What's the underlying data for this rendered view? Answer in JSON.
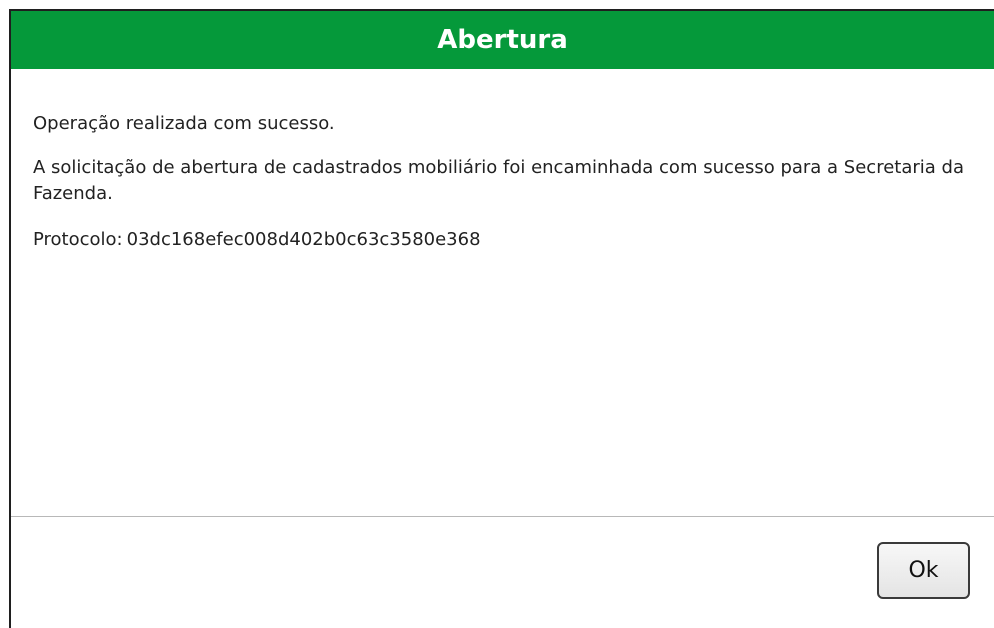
{
  "dialog": {
    "title": "Abertura",
    "colors": {
      "title_bar": "#05993a",
      "title_text": "#ffffff"
    },
    "messages": {
      "success": "Operação realizada com sucesso.",
      "detail": "A solicitação de abertura de cadastrados mobiliário foi encaminhada com sucesso para a Secretaria da Fazenda.",
      "protocol_label": "Protocolo:",
      "protocol_value": "03dc168efec008d402b0c63c3580e368"
    },
    "buttons": {
      "ok_label": "Ok"
    }
  }
}
